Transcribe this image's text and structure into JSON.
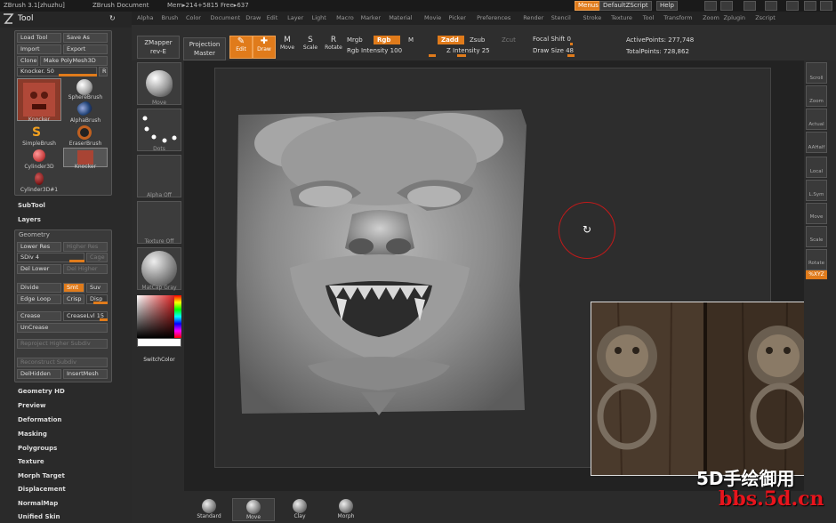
{
  "titlebar": {
    "app": "ZBrush  3.1[zhuzhu]",
    "document": "ZBrush Document",
    "mem": "Mem▸214+5815 Free▸637",
    "menus": "Menus",
    "script": "DefaultZScript",
    "help": "Help"
  },
  "menu": [
    "Alpha",
    "Brush",
    "Color",
    "Document",
    "Draw",
    "Edit",
    "Layer",
    "Light",
    "Macro",
    "Marker",
    "Material",
    "Movie",
    "Picker",
    "Preferences",
    "Render",
    "Stencil",
    "Stroke",
    "Texture",
    "Tool",
    "Transform",
    "Zoom",
    "Zplugin",
    "Zscript"
  ],
  "tool": {
    "title": "Tool",
    "load": "Load Tool",
    "save": "Save As",
    "import": "Import",
    "export": "Export",
    "clone": "Clone",
    "polymesh": "Make PolyMesh3D",
    "knocker_label": "Knocker. 50",
    "r": "R",
    "thumbs": [
      "Knocker",
      "SphereBrush",
      "AlphaBrush",
      "SimpleBrush",
      "EraserBrush",
      "Cylinder3D",
      "Knocker",
      "Cylinder3D#1"
    ]
  },
  "sections": {
    "subtool": "SubTool",
    "layers": "Layers",
    "geometry": "Geometry",
    "geometry_hd": "Geometry HD",
    "preview": "Preview",
    "deformation": "Deformation",
    "masking": "Masking",
    "polygroups": "Polygroups",
    "texture": "Texture",
    "morph_target": "Morph Target",
    "displacement": "Displacement",
    "normalmap": "NormalMap",
    "unified_skin": "Unified Skin"
  },
  "geometry": {
    "lower_res": "Lower Res",
    "higher_res": "Higher Res",
    "sdiv": "SDiv 4",
    "cage": "Cage",
    "del_lower": "Del Lower",
    "del_higher": "Del Higher",
    "divide": "Divide",
    "smt": "Smt",
    "suv": "Suv",
    "edge_loop": "Edge Loop",
    "crisp": "Crisp",
    "disp": "Disp",
    "crease": "Crease",
    "creaselvl": "CreaseLvl 15",
    "uncrease": "UnCrease",
    "reproject": "Reproject Higher Subdiv",
    "reconstruct": "Reconstruct Subdiv",
    "delhidden": "DelHidden",
    "insertmesh": "InsertMesh"
  },
  "shelf": {
    "zmapper": "ZMapper",
    "zmapper_sub": "rev-E",
    "projection": "Projection",
    "projection_sub": "Master",
    "edit": "Edit",
    "draw": "Draw",
    "move": "Move",
    "scale": "Scale",
    "rotate": "Rotate",
    "mrgb": "Mrgb",
    "rgb": "Rgb",
    "m": "M",
    "rgb_intensity": "Rgb Intensity 100",
    "zadd": "Zadd",
    "zsub": "Zsub",
    "zcut": "Zcut",
    "z_intensity": "Z Intensity 25",
    "focal_shift": "Focal Shift 0",
    "draw_size": "Draw Size 48",
    "active_points": "ActivePoints: 277,748",
    "total_points": "TotalPoints: 728,862"
  },
  "materials": [
    "Move",
    "Dots",
    "Alpha Off",
    "Texture Off",
    "MatCap Gray"
  ],
  "switchcolor": "SwitchColor",
  "right_shelf": [
    "Scroll",
    "Zoom",
    "Actual",
    "AAHalf",
    "Local",
    "L.Sym",
    "Move",
    "Scale",
    "Rotate",
    "%XYZ"
  ],
  "bottom_shelf": [
    "Standard",
    "Move",
    "Clay",
    "Morph"
  ],
  "watermark": {
    "line1": "5D手绘御用",
    "line2": "bbs.5d.cn"
  },
  "colors": {
    "accent": "#e07b1b",
    "panel": "#2a2a2a",
    "brush_ring": "#c01a1a"
  }
}
